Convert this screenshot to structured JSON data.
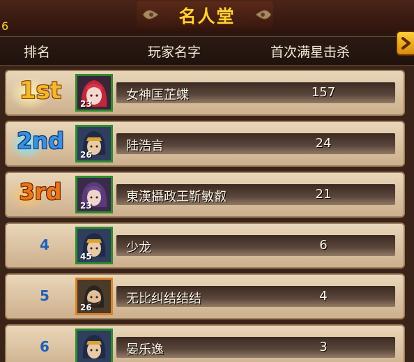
{
  "title": "名人堂",
  "corner_number": "6",
  "headers": {
    "rank": "排名",
    "player": "玩家名字",
    "kills": "首次满星击杀"
  },
  "colors": {
    "gold": "#ffd23a",
    "blue_rank": "#1e60b8",
    "frame_green": "#2e8b2e",
    "frame_orange": "#d9822b"
  },
  "rows": [
    {
      "rank": "1st",
      "level": "23",
      "name": "女神匡芷蝶",
      "kills": "157",
      "avatar_icon": "red-hair-girl-portrait-icon"
    },
    {
      "rank": "2nd",
      "level": "26",
      "name": "陆浩言",
      "kills": "24",
      "avatar_icon": "hero-portrait-icon"
    },
    {
      "rank": "3rd",
      "level": "23",
      "name": "東漢攝政王靳敏叡",
      "kills": "21",
      "avatar_icon": "purple-hair-portrait-icon"
    },
    {
      "rank": "4",
      "level": "45",
      "name": "少龙",
      "kills": "6",
      "avatar_icon": "hero-portrait-icon"
    },
    {
      "rank": "5",
      "level": "26",
      "name": "无比纠结结结",
      "kills": "4",
      "avatar_icon": "bearded-warrior-portrait-icon"
    },
    {
      "rank": "6",
      "level": "",
      "name": "晏乐逸",
      "kills": "3",
      "avatar_icon": "hero-portrait-icon"
    }
  ]
}
